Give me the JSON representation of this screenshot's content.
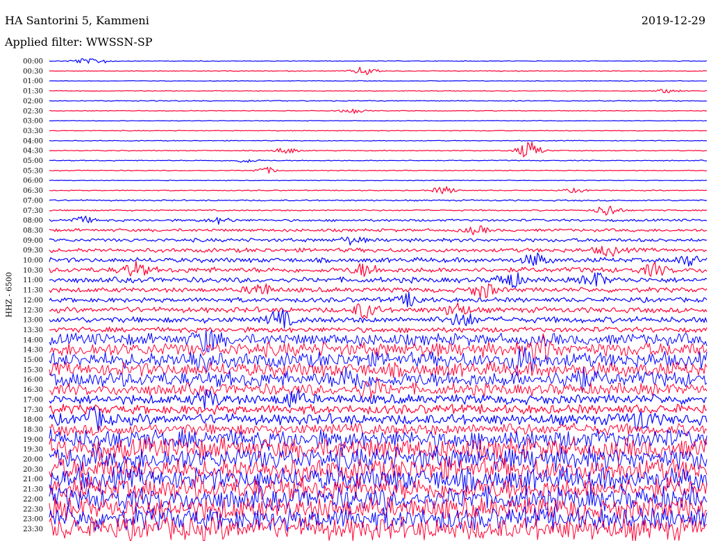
{
  "header": {
    "station": "HA Santorini 5, Kammeni",
    "date": "2019-12-29",
    "filter_label": "Applied filter: WWSSN-SP"
  },
  "colors": {
    "even_trace": "#0000ff",
    "odd_trace": "#ff0033"
  },
  "chart_data": {
    "type": "line",
    "subtype": "helicorder",
    "channel_label": "HHZ - 6500",
    "row_labels": [
      "00:00",
      "00:30",
      "01:00",
      "01:30",
      "02:00",
      "02:30",
      "03:00",
      "03:30",
      "04:00",
      "04:30",
      "05:00",
      "05:30",
      "06:00",
      "06:30",
      "07:00",
      "07:30",
      "08:00",
      "08:30",
      "09:00",
      "09:30",
      "10:00",
      "10:30",
      "11:00",
      "11:30",
      "12:00",
      "12:30",
      "13:00",
      "13:30",
      "14:00",
      "14:30",
      "15:00",
      "15:30",
      "16:00",
      "16:30",
      "17:00",
      "17:30",
      "18:00",
      "18:30",
      "19:00",
      "19:30",
      "20:00",
      "20:30",
      "21:00",
      "21:30",
      "22:00",
      "22:30",
      "23:00",
      "23:30"
    ],
    "noise_level": [
      0.05,
      0.07,
      0.05,
      0.06,
      0.08,
      0.06,
      0.05,
      0.06,
      0.07,
      0.08,
      0.08,
      0.07,
      0.06,
      0.08,
      0.12,
      0.12,
      0.2,
      0.25,
      0.3,
      0.35,
      0.4,
      0.45,
      0.45,
      0.4,
      0.4,
      0.45,
      0.5,
      0.45,
      1.0,
      1.2,
      1.3,
      1.2,
      1.3,
      1.0,
      0.8,
      0.8,
      0.9,
      1.0,
      1.6,
      1.8,
      1.9,
      1.9,
      1.9,
      1.9,
      1.9,
      1.9,
      1.9,
      1.9
    ],
    "events": [
      {
        "row": 0,
        "pos": 0.05,
        "amp": 0.5
      },
      {
        "row": 0,
        "pos": 0.08,
        "amp": 0.4
      },
      {
        "row": 1,
        "pos": 0.48,
        "amp": 0.9
      },
      {
        "row": 3,
        "pos": 0.94,
        "amp": 0.4
      },
      {
        "row": 5,
        "pos": 0.46,
        "amp": 0.5
      },
      {
        "row": 9,
        "pos": 0.36,
        "amp": 0.6
      },
      {
        "row": 9,
        "pos": 0.73,
        "amp": 1.8
      },
      {
        "row": 10,
        "pos": 0.3,
        "amp": 0.4
      },
      {
        "row": 11,
        "pos": 0.33,
        "amp": 0.6
      },
      {
        "row": 13,
        "pos": 0.6,
        "amp": 0.8
      },
      {
        "row": 13,
        "pos": 0.8,
        "amp": 0.4
      },
      {
        "row": 15,
        "pos": 0.85,
        "amp": 1.2
      },
      {
        "row": 16,
        "pos": 0.05,
        "amp": 0.7
      },
      {
        "row": 16,
        "pos": 0.26,
        "amp": 0.6
      },
      {
        "row": 17,
        "pos": 0.65,
        "amp": 0.7
      },
      {
        "row": 18,
        "pos": 0.46,
        "amp": 0.7
      },
      {
        "row": 19,
        "pos": 0.85,
        "amp": 1.0
      },
      {
        "row": 20,
        "pos": 0.74,
        "amp": 1.2
      },
      {
        "row": 20,
        "pos": 0.97,
        "amp": 1.0
      },
      {
        "row": 21,
        "pos": 0.13,
        "amp": 1.4
      },
      {
        "row": 21,
        "pos": 0.48,
        "amp": 1.2
      },
      {
        "row": 21,
        "pos": 0.92,
        "amp": 1.1
      },
      {
        "row": 22,
        "pos": 0.7,
        "amp": 1.6
      },
      {
        "row": 22,
        "pos": 0.83,
        "amp": 1.4
      },
      {
        "row": 23,
        "pos": 0.32,
        "amp": 1.3
      },
      {
        "row": 23,
        "pos": 0.66,
        "amp": 1.5
      },
      {
        "row": 24,
        "pos": 0.55,
        "amp": 1.2
      },
      {
        "row": 25,
        "pos": 0.48,
        "amp": 1.5
      },
      {
        "row": 25,
        "pos": 0.62,
        "amp": 1.3
      },
      {
        "row": 26,
        "pos": 0.35,
        "amp": 1.8
      },
      {
        "row": 26,
        "pos": 0.63,
        "amp": 1.4
      },
      {
        "row": 28,
        "pos": 0.24,
        "amp": 2.0
      },
      {
        "row": 29,
        "pos": 0.75,
        "amp": 2.2
      },
      {
        "row": 30,
        "pos": 0.23,
        "amp": 2.0
      },
      {
        "row": 30,
        "pos": 0.72,
        "amp": 2.3
      },
      {
        "row": 32,
        "pos": 0.46,
        "amp": 2.0
      },
      {
        "row": 32,
        "pos": 0.8,
        "amp": 2.2
      },
      {
        "row": 33,
        "pos": 0.49,
        "amp": 1.7
      },
      {
        "row": 34,
        "pos": 0.24,
        "amp": 1.5
      },
      {
        "row": 34,
        "pos": 0.37,
        "amp": 1.5
      },
      {
        "row": 36,
        "pos": 0.07,
        "amp": 1.6
      },
      {
        "row": 36,
        "pos": 0.9,
        "amp": 1.8
      }
    ]
  }
}
